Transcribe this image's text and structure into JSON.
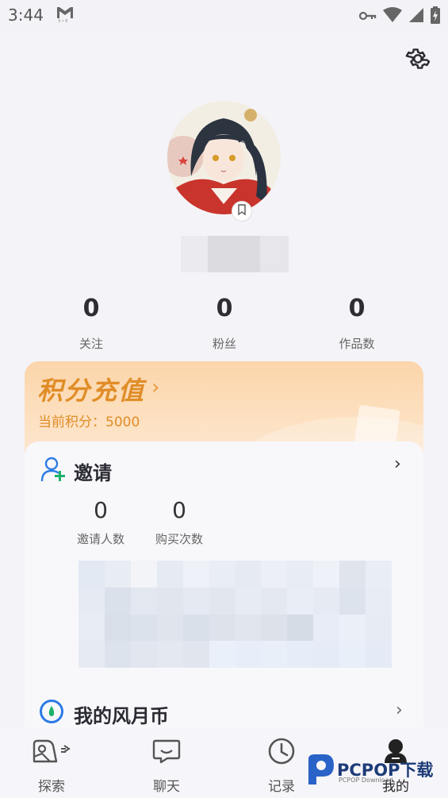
{
  "status_bar": {
    "time": "3:44"
  },
  "profile": {
    "stats": [
      {
        "value": "0",
        "label": "关注"
      },
      {
        "value": "0",
        "label": "粉丝"
      },
      {
        "value": "0",
        "label": "作品数"
      }
    ]
  },
  "recharge": {
    "title": "积分充值",
    "chevron": "›",
    "points_label": "当前积分：5000"
  },
  "invite": {
    "title": "邀请",
    "chevron": "›",
    "stats": [
      {
        "value": "0",
        "label": "邀请人数"
      },
      {
        "value": "0",
        "label": "购买次数"
      }
    ]
  },
  "coin": {
    "title": "我的风月币",
    "chevron": "›"
  },
  "bottom_nav": [
    {
      "label": "探索",
      "icon": "explore-icon"
    },
    {
      "label": "聊天",
      "icon": "chat-icon"
    },
    {
      "label": "记录",
      "icon": "clock-icon"
    },
    {
      "label": "我的",
      "icon": "profile-icon"
    }
  ],
  "watermark": {
    "brand": "PCPOP下载",
    "sub": "PCPOP Download"
  },
  "colors": {
    "accent_orange": "#e08d27",
    "invite_icon_blue": "#2c7be5",
    "invite_icon_green": "#1fb16a",
    "background": "#f4f3f7"
  }
}
